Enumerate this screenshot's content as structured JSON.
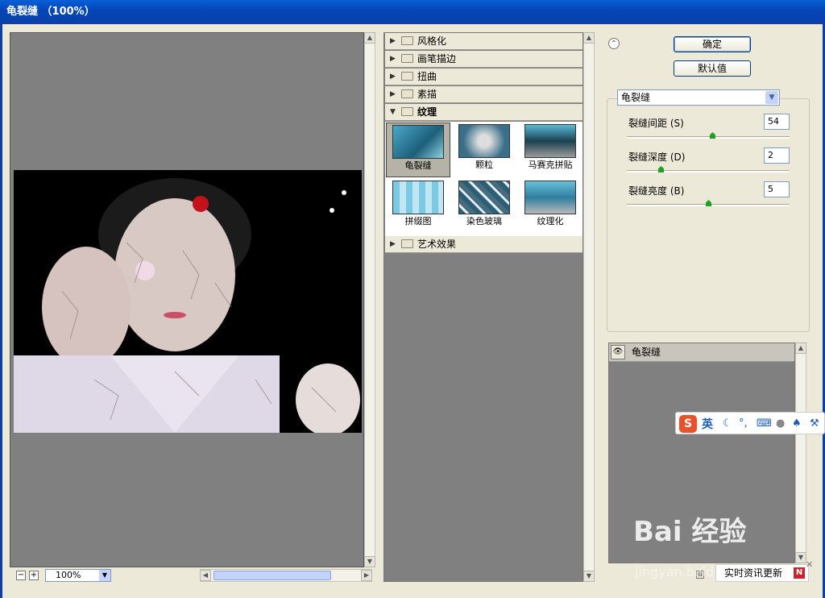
{
  "window": {
    "title": "龟裂缝 （100%）"
  },
  "preview": {
    "zoom": "100%",
    "zoom_out": "−",
    "zoom_in": "+"
  },
  "filter_tree": {
    "categories_top": [
      {
        "label": "风格化",
        "expanded": false
      },
      {
        "label": "画笔描边",
        "expanded": false
      },
      {
        "label": "扭曲",
        "expanded": false
      },
      {
        "label": "素描",
        "expanded": false
      },
      {
        "label": "纹理",
        "expanded": true
      }
    ],
    "texture_filters": [
      "龟裂缝",
      "颗粒",
      "马赛克拼贴",
      "拼缀图",
      "染色玻璃",
      "纹理化"
    ],
    "selected_filter": "龟裂缝",
    "categories_bottom": [
      {
        "label": "艺术效果",
        "expanded": false
      }
    ]
  },
  "buttons": {
    "ok": "确定",
    "reset": "默认值"
  },
  "filter_select": {
    "value": "龟裂缝"
  },
  "params": [
    {
      "label": "裂缝间距 (S)",
      "value": "54",
      "fraction": 0.53
    },
    {
      "label": "裂缝深度 (D)",
      "value": "2",
      "fraction": 0.2
    },
    {
      "label": "裂缝亮度 (B)",
      "value": "5",
      "fraction": 0.5
    }
  ],
  "layers": [
    {
      "name": "龟裂缝",
      "visible": true
    }
  ],
  "ime_toolbar": {
    "logo": "S",
    "mode": "英"
  },
  "watermark": {
    "text": "Bai 经验",
    "url": "jingyan.baidu.com"
  },
  "news_popup": {
    "text": "实时资讯更新",
    "badge": "N"
  },
  "colors": {
    "title_bar": "#0447b8",
    "dialog_bg": "#ece9d8",
    "canvas_gray": "#808080",
    "slider_knob": "#21a121"
  }
}
